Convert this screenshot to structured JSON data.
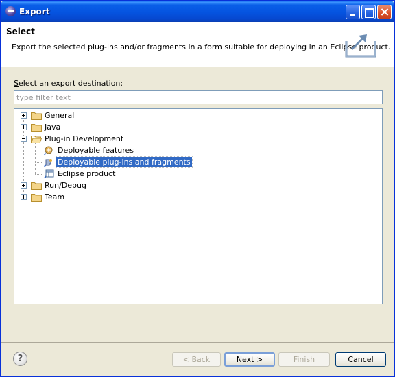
{
  "window": {
    "title": "Export"
  },
  "banner": {
    "title": "Select",
    "description": "Export the selected plug-ins and/or fragments in a form suitable for deploying in an Eclipse product.",
    "icon": "export-wizard-icon"
  },
  "destination": {
    "label_prefix": "S",
    "label_rest": "elect an export destination:",
    "filter_placeholder": "type filter text"
  },
  "tree": {
    "items": [
      {
        "label": "General",
        "icon": "folder-icon",
        "expanded": false
      },
      {
        "label": "Java",
        "icon": "folder-icon",
        "expanded": false
      },
      {
        "label": "Plug-in Development",
        "icon": "folder-open-icon",
        "expanded": true
      },
      {
        "label": "Deployable features",
        "icon": "feature-export-icon"
      },
      {
        "label": "Deployable plug-ins and fragments",
        "icon": "plugin-export-icon",
        "selected": true
      },
      {
        "label": "Eclipse product",
        "icon": "product-icon"
      },
      {
        "label": "Run/Debug",
        "icon": "folder-icon",
        "expanded": false
      },
      {
        "label": "Team",
        "icon": "folder-icon",
        "expanded": false
      }
    ]
  },
  "buttons": {
    "back": {
      "prefix": "< ",
      "mnemonic": "B",
      "rest": "ack",
      "enabled": false
    },
    "next": {
      "mnemonic": "N",
      "rest": "ext >",
      "enabled": true
    },
    "finish": {
      "mnemonic": "F",
      "rest": "inish",
      "enabled": false
    },
    "cancel": {
      "label": "Cancel",
      "enabled": true
    },
    "help": "?"
  },
  "colors": {
    "titlebar": "#0554e0",
    "selection": "#316ac5",
    "dialog_bg": "#ece9d8"
  }
}
